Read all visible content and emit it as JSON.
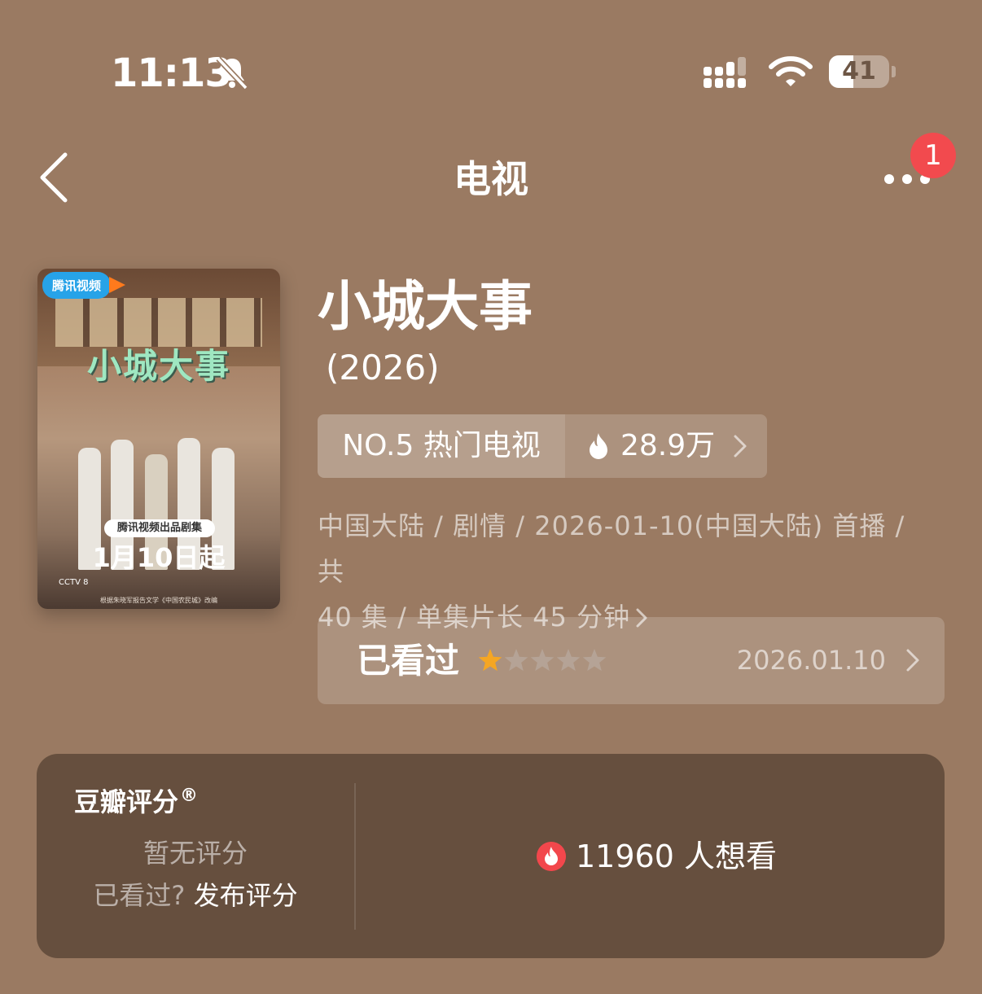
{
  "status_bar": {
    "time": "11:13",
    "battery_level": "41",
    "battery_fraction": 0.41
  },
  "nav": {
    "title": "电视",
    "badge_count": "1"
  },
  "poster": {
    "platform_tag": "腾讯视频",
    "title_art": "小城大事",
    "pill_text": "腾讯视频出品剧集",
    "air_date_text": "1月10日起",
    "logo_text": "CCTV 8",
    "credit_text": "根据朱晓军报告文学《中国农民城》改编"
  },
  "show": {
    "title": "小城大事",
    "year": "(2026)",
    "rank_label": "NO.5 热门电视",
    "heat_value": "28.9万",
    "meta_line1": "中国大陆 / 剧情 / 2026-01-10(中国大陆) 首播 / 共",
    "meta_line2": "40 集 / 单集片长 45 分钟"
  },
  "watched": {
    "label": "已看过",
    "rating": 1,
    "max_rating": 5,
    "date": "2026.01.10"
  },
  "rating_card": {
    "title": "豆瓣评分",
    "registered_mark": "®",
    "no_rating": "暂无评分",
    "seen_question": "已看过?",
    "post_rating": "发布评分",
    "want_count_text": "11960 人想看"
  },
  "colors": {
    "background": "#9a7a62",
    "card": "#664f3e",
    "badge": "#f24a4e",
    "star_active": "#f5a623",
    "star_inactive": "#b5a396"
  },
  "icons": {
    "bell": "bell-slash-icon",
    "signal": "cellular-signal-icon",
    "wifi": "wifi-icon",
    "back": "chevron-left-icon",
    "more": "ellipsis-icon",
    "flame": "flame-icon",
    "chevron": "chevron-right-icon",
    "star": "star-icon"
  }
}
